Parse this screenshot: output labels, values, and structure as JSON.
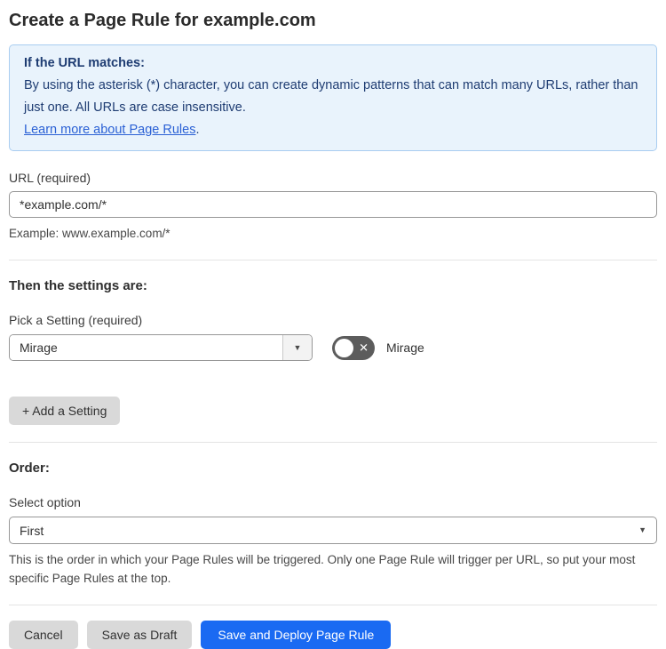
{
  "page": {
    "title": "Create a Page Rule for example.com"
  },
  "info_box": {
    "heading": "If the URL matches:",
    "body": "By using the asterisk (*) character, you can create dynamic patterns that can match many URLs, rather than just one. All URLs are case insensitive.",
    "link_label": "Learn more about Page Rules",
    "link_suffix": "."
  },
  "url_field": {
    "label": "URL (required)",
    "value": "*example.com/*",
    "helper": "Example: www.example.com/*"
  },
  "settings_section": {
    "heading": "Then the settings are:",
    "pick_label": "Pick a Setting (required)",
    "selected_setting": "Mirage",
    "toggle_label": "Mirage",
    "toggle_state": "off",
    "toggle_glyph": "✕",
    "caret_glyph": "▼",
    "add_button_label": "+ Add a Setting"
  },
  "order_section": {
    "heading": "Order:",
    "select_label": "Select option",
    "selected_option": "First",
    "caret_glyph": "▼",
    "helper": "This is the order in which your Page Rules will be triggered. Only one Page Rule will trigger per URL, so put your most specific Page Rules at the top."
  },
  "footer": {
    "cancel_label": "Cancel",
    "save_draft_label": "Save as Draft",
    "save_deploy_label": "Save and Deploy Page Rule"
  },
  "colors": {
    "accent_blue": "#1a6af2",
    "info_background": "#e9f3fc",
    "info_border": "#a9cdf1",
    "info_text": "#1e3c72",
    "link_blue": "#2b61d5",
    "toggle_off_gray": "#5c5c5c",
    "button_gray": "#d9d9d9"
  }
}
